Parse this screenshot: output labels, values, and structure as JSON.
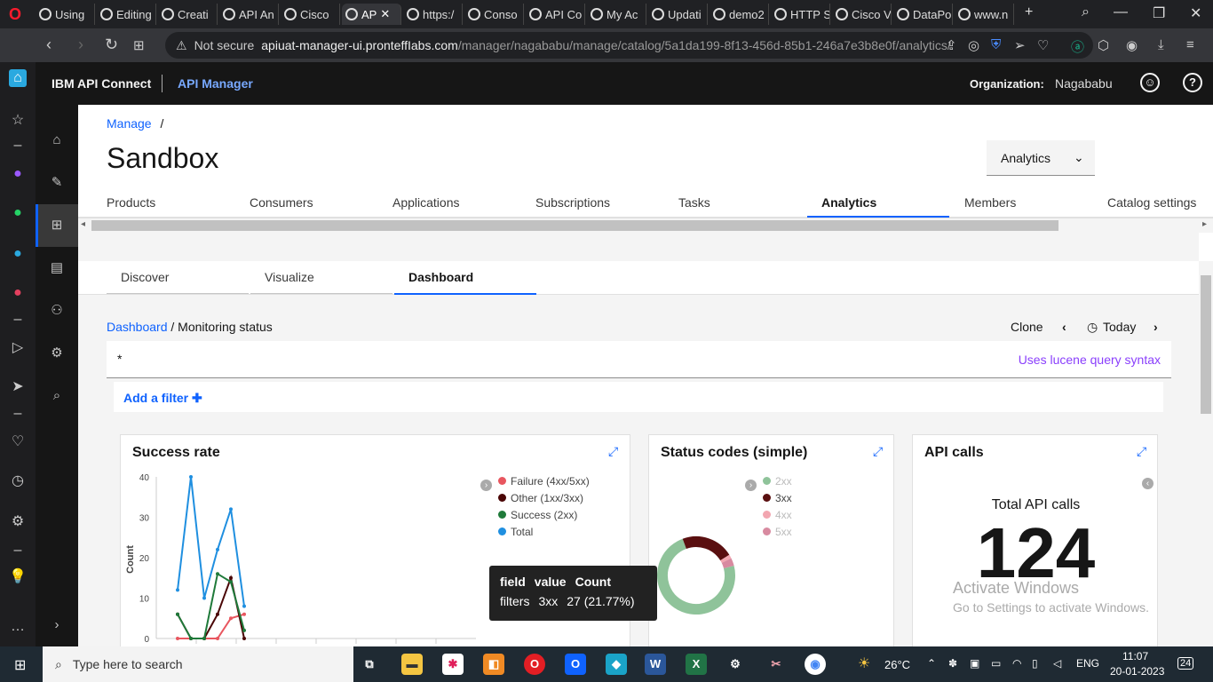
{
  "browser": {
    "tabs": [
      {
        "label": "Using"
      },
      {
        "label": "Editing"
      },
      {
        "label": "Creati"
      },
      {
        "label": "API An"
      },
      {
        "label": "Cisco"
      },
      {
        "label": "AP",
        "active": true
      },
      {
        "label": "https:/"
      },
      {
        "label": "Conso"
      },
      {
        "label": "API Co"
      },
      {
        "label": "My Ac"
      },
      {
        "label": "Updati"
      },
      {
        "label": "demo2"
      },
      {
        "label": "HTTP S"
      },
      {
        "label": "Cisco V"
      },
      {
        "label": "DataPo"
      },
      {
        "label": "www.n"
      }
    ],
    "not_secure": "Not secure",
    "url_domain": "apiuat-manager-ui.pronteffIabs.com",
    "url_path": "/manager/nagababu/manage/catalog/5a1da199-8f13-456d-85b1-246a7e3b8e0f/analytics/"
  },
  "header": {
    "brand": "IBM API Connect",
    "product": "API Manager",
    "org_label": "Organization:",
    "org_value": "Nagababu"
  },
  "page": {
    "breadcrumb": "Manage",
    "breadcrumb_sep": "/",
    "title": "Sandbox",
    "view_select": "Analytics",
    "tabs": [
      "Products",
      "Consumers",
      "Applications",
      "Subscriptions",
      "Tasks",
      "Analytics",
      "Members",
      "Catalog settings"
    ],
    "subtabs": [
      "Discover",
      "Visualize",
      "Dashboard"
    ]
  },
  "dashboard": {
    "crumb_link": "Dashboard",
    "crumb_sep": "/",
    "crumb_current": "Monitoring status",
    "clone": "Clone",
    "time": "Today",
    "query": "*",
    "query_hint": "Uses lucene query syntax",
    "add_filter": "Add a filter"
  },
  "panels": {
    "success_rate": {
      "title": "Success rate",
      "legend": [
        "Failure (4xx/5xx)",
        "Other (1xx/3xx)",
        "Success (2xx)",
        "Total"
      ],
      "ylabel": "Count",
      "yticks": [
        "40",
        "30",
        "20",
        "10",
        "0"
      ]
    },
    "status_codes": {
      "title": "Status codes (simple)",
      "legend": [
        "2xx",
        "3xx",
        "4xx",
        "5xx"
      ]
    },
    "api_calls": {
      "title": "API calls",
      "label": "Total API calls",
      "value": "124"
    }
  },
  "tooltip": {
    "headers": [
      "field",
      "value",
      "Count"
    ],
    "row": [
      "filters",
      "3xx",
      "27 (21.77%)"
    ]
  },
  "watermark": {
    "line1": "Activate Windows",
    "line2": "Go to Settings to activate Windows."
  },
  "taskbar": {
    "search_placeholder": "Type here to search",
    "temperature": "26°C",
    "language": "ENG",
    "time": "11:07",
    "date": "20-01-2023",
    "notifications": "24"
  },
  "colors": {
    "failure": "#e8565f",
    "other": "#4a0606",
    "success": "#1f7a3a",
    "total": "#1f8fe0",
    "s2xx": "#8fc39a",
    "s3xx": "#5a0f10",
    "s4xx": "#f2a6b0",
    "s5xx": "#d88aa0",
    "accent": "#0f62fe"
  },
  "chart_data": [
    {
      "type": "line",
      "title": "Success rate",
      "ylabel": "Count",
      "ylim": [
        0,
        40
      ],
      "x": [
        1,
        2,
        3,
        4,
        5,
        6,
        7,
        8
      ],
      "series": [
        {
          "name": "Total",
          "values": [
            12,
            40,
            10,
            22,
            32,
            8,
            null,
            null
          ]
        },
        {
          "name": "Success (2xx)",
          "values": [
            6,
            0,
            0,
            16,
            14,
            2,
            null,
            null
          ]
        },
        {
          "name": "Other (1xx/3xx)",
          "values": [
            6,
            0,
            0,
            6,
            15,
            0,
            null,
            null
          ]
        },
        {
          "name": "Failure (4xx/5xx)",
          "values": [
            0,
            0,
            0,
            0,
            5,
            6,
            null,
            null
          ]
        }
      ]
    },
    {
      "type": "pie",
      "title": "Status codes (simple)",
      "categories": [
        "2xx",
        "3xx",
        "4xx",
        "5xx"
      ],
      "values": [
        91,
        27,
        2,
        4
      ]
    }
  ]
}
